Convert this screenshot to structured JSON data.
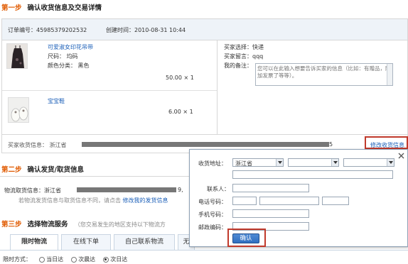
{
  "step1": {
    "number": "第一步",
    "title": "确认收货信息及交易详情"
  },
  "order": {
    "number_label": "订单编号：45985379202532",
    "created_label": "创建时间：2010-08-31 10:44"
  },
  "products": [
    {
      "name": "可爱淑女印花吊带",
      "size": "尺码：  均码",
      "color": "颜色分类：  黑色",
      "price": "50.00 × 1"
    },
    {
      "name": "宝宝鞋",
      "price": "6.00 × 1"
    }
  ],
  "buyer": {
    "choice": "买家选择：快递",
    "message": "买家留言：qqq",
    "remark_label": "我的备注：",
    "remark_placeholder": "您可以在此输入想要告诉买家的信息（比如：有赠品，附加发票了等等）。"
  },
  "shipping_address": {
    "label": "买家收货信息：  浙江省",
    "suffix": "5",
    "edit_link": "修改收货信息"
  },
  "step2": {
    "number": "第二步",
    "title": "确认发货/取货信息",
    "pickup_label": "物流取货信息：浙江省",
    "pickup_suffix": "9,",
    "note": "若物流发货信息与取货信息不同，请点击",
    "note_link": "修改我的发货信息"
  },
  "step3": {
    "number": "第三步",
    "title": "选择物流服务",
    "subtitle": "（您交易发生的地区支持以下物流方"
  },
  "tabs": [
    "限时物流",
    "在线下单",
    "自己联系物流",
    "无"
  ],
  "time_method": {
    "label": "限时方式：",
    "options": [
      "当日达",
      "次晨达",
      "次日达"
    ],
    "selected_index": 2
  },
  "popup": {
    "address_label": "收货地址：",
    "province_value": "浙江省",
    "contact_label": "联系人：",
    "phone_label": "电话号码：",
    "mobile_label": "手机号码：",
    "postcode_label": "邮政编码：",
    "confirm_button": "确认",
    "close_icon": "close-icon"
  },
  "colors": {
    "step_number": "#e05a00",
    "link": "#1b5fb8",
    "highlight_border": "#c0392b",
    "confirm_button": "#2f6fc0"
  }
}
